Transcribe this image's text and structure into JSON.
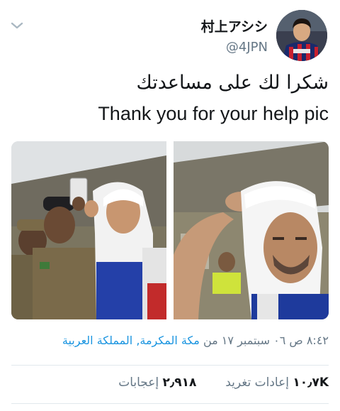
{
  "tweet": {
    "display_name": "村上アシシ",
    "handle": "@4JPN",
    "avatar_icon": "user-avatar-icon",
    "text_ar": "شكرا لك على مساعدتك",
    "text_en": "Thank you for your help pic",
    "time": "٨:٤٢ ص ٠٦ سبتمبر ١٧ من",
    "location": "مكة المكرمة, المملكة العربية",
    "retweets_count": "١٠٫٧K",
    "retweets_label": "إعادات تغريد",
    "likes_count": "٢٫٩١٨",
    "likes_label": "إعجابات"
  },
  "colors": {
    "text": "#14171a",
    "muted": "#657786",
    "link": "#1b95e0",
    "divider": "#e1e8ed"
  }
}
